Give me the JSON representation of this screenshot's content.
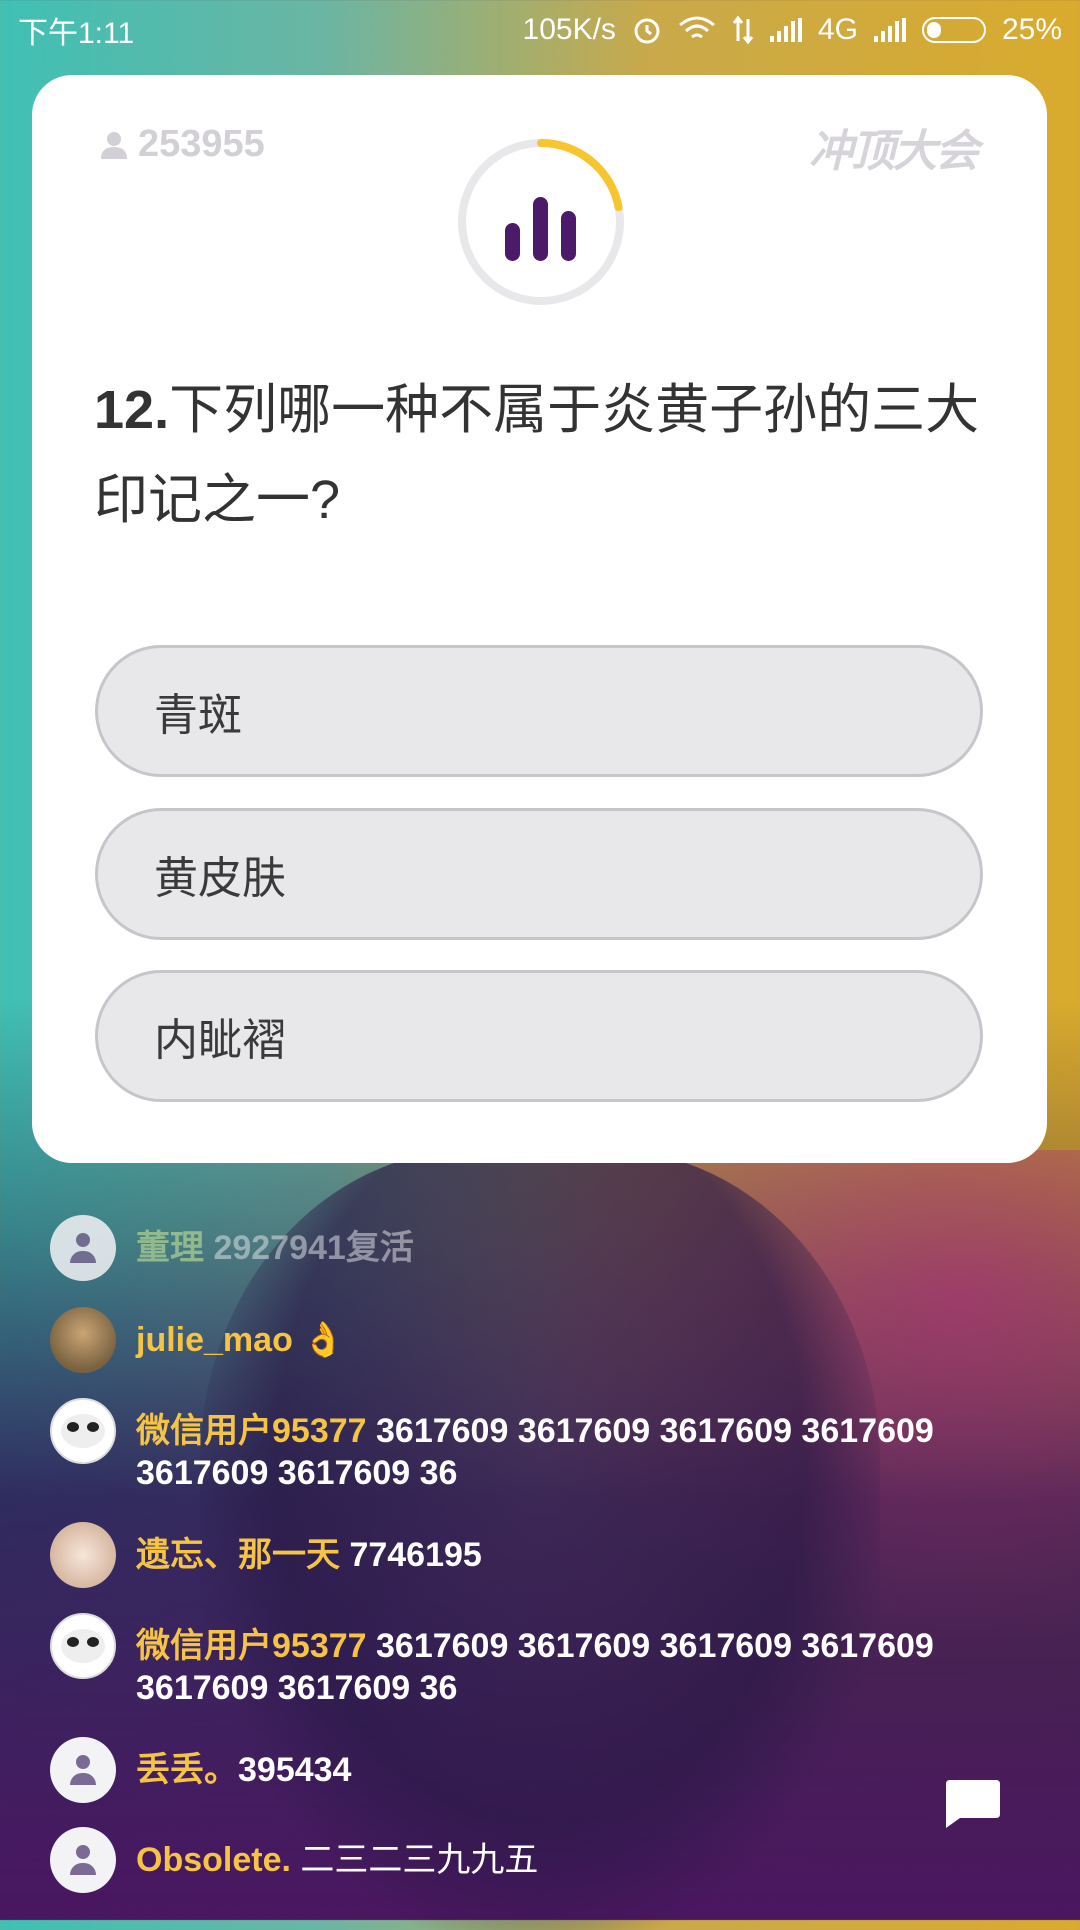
{
  "status_bar": {
    "time": "下午1:11",
    "speed": "105K/s",
    "network": "4G",
    "battery": "25%",
    "battery_level": 0.25
  },
  "quiz": {
    "viewer_count": "253955",
    "logo_text": "冲顶大会",
    "question_number": "12.",
    "question_text": "下列哪一种不属于炎黄子孙的三大印记之一?",
    "timer_progress": 0.22,
    "options": [
      "青斑",
      "黄皮肤",
      "内眦褶"
    ],
    "colors": {
      "accent": "#f7c52e",
      "timer_icon": "#4b1a68"
    }
  },
  "chat": {
    "messages": [
      {
        "name": "董理",
        "text": "2927941复活",
        "avatar": "default"
      },
      {
        "name": "julie_mao",
        "text": "👌",
        "avatar": "photo"
      },
      {
        "name": "微信用户95377",
        "text": "3617609 3617609 3617609 3617609 3617609 3617609 36",
        "avatar": "panda"
      },
      {
        "name": "遗忘、那一天",
        "text": "7746195",
        "avatar": "couple"
      },
      {
        "name": "微信用户95377",
        "text": "3617609 3617609 3617609 3617609 3617609 3617609 36",
        "avatar": "panda"
      },
      {
        "name": "丢丢。",
        "text": "395434",
        "avatar": "default"
      },
      {
        "name": "Obsolete.",
        "text": "二三二三九九五",
        "avatar": "default"
      }
    ]
  },
  "icons": [
    "alarm-icon",
    "wifi-icon",
    "data-arrows-icon",
    "signal-icon",
    "battery-icon",
    "person-icon",
    "bar-chart-icon",
    "chat-bubble-icon"
  ]
}
